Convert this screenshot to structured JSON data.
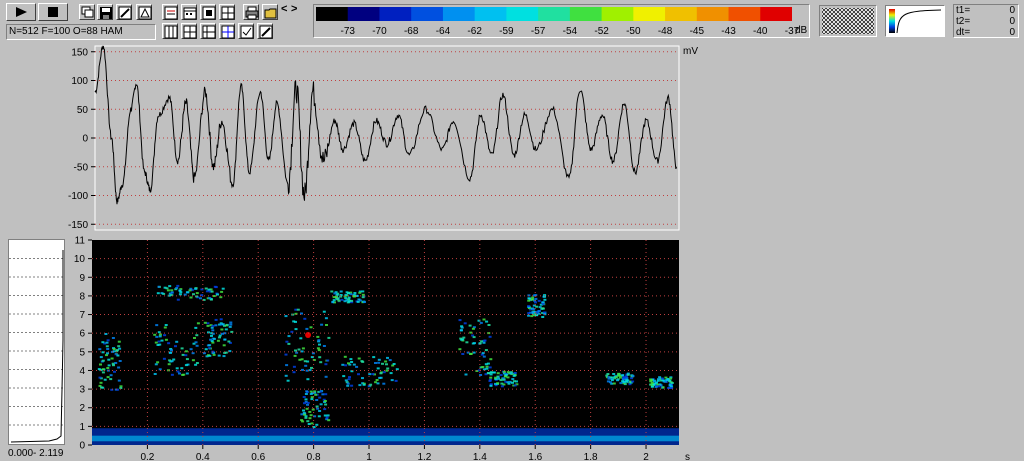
{
  "status": {
    "params": "N=512 F=100 O=88 HAM",
    "range": "0.000- 2.119"
  },
  "toolbar": {
    "play_icon": "play-icon",
    "stop_icon": "stop-icon",
    "nav_left": "<",
    "nav_right": ">"
  },
  "colorbar": {
    "ticks": [
      "-73",
      "-70",
      "-68",
      "-64",
      "-62",
      "-59",
      "-57",
      "-54",
      "-52",
      "-50",
      "-48",
      "-45",
      "-43",
      "-40",
      "-37"
    ],
    "unit": "dB",
    "colors": [
      "#000000",
      "#000080",
      "#0020c0",
      "#0050e0",
      "#0090f0",
      "#00c0f0",
      "#00e0e0",
      "#20e0a0",
      "#40e040",
      "#a0f000",
      "#f0f000",
      "#f0c000",
      "#f09000",
      "#f05000",
      "#e00000"
    ]
  },
  "cursor_info": {
    "t1_label": "t1=",
    "t1_value": "0",
    "t2_label": "t2=",
    "t2_value": "0",
    "dt_label": "dt=",
    "dt_value": "0"
  },
  "chart_data": [
    {
      "type": "line",
      "ylabel": "mV",
      "ylim": [
        -160,
        160
      ],
      "yticks": [
        "150",
        "100",
        "50",
        "0",
        "-50",
        "-100",
        "-150"
      ],
      "xlim": [
        0,
        2.119
      ],
      "grid": true,
      "series": [
        {
          "values_description_points": [
            [
              0.0,
              80
            ],
            [
              0.03,
              160
            ],
            [
              0.06,
              0
            ],
            [
              0.08,
              -110
            ],
            [
              0.1,
              -80
            ],
            [
              0.13,
              50
            ],
            [
              0.15,
              95
            ],
            [
              0.18,
              -60
            ],
            [
              0.2,
              -90
            ],
            [
              0.23,
              40
            ],
            [
              0.27,
              70
            ],
            [
              0.3,
              -40
            ],
            [
              0.33,
              60
            ],
            [
              0.36,
              -70
            ],
            [
              0.4,
              80
            ],
            [
              0.43,
              -50
            ],
            [
              0.46,
              30
            ],
            [
              0.5,
              -80
            ],
            [
              0.53,
              90
            ],
            [
              0.56,
              -60
            ],
            [
              0.6,
              80
            ],
            [
              0.63,
              -40
            ],
            [
              0.66,
              60
            ],
            [
              0.7,
              -80
            ],
            [
              0.73,
              85
            ],
            [
              0.76,
              -100
            ],
            [
              0.79,
              80
            ],
            [
              0.83,
              -40
            ],
            [
              0.87,
              30
            ],
            [
              0.9,
              -20
            ],
            [
              0.94,
              25
            ],
            [
              0.98,
              -40
            ],
            [
              1.02,
              30
            ],
            [
              1.06,
              -10
            ],
            [
              1.1,
              40
            ],
            [
              1.14,
              -30
            ],
            [
              1.2,
              50
            ],
            [
              1.26,
              -20
            ],
            [
              1.3,
              30
            ],
            [
              1.36,
              -70
            ],
            [
              1.4,
              40
            ],
            [
              1.44,
              -30
            ],
            [
              1.48,
              75
            ],
            [
              1.52,
              -30
            ],
            [
              1.56,
              40
            ],
            [
              1.6,
              -20
            ],
            [
              1.66,
              50
            ],
            [
              1.72,
              -70
            ],
            [
              1.76,
              85
            ],
            [
              1.8,
              -20
            ],
            [
              1.84,
              40
            ],
            [
              1.88,
              -40
            ],
            [
              1.92,
              60
            ],
            [
              1.96,
              -60
            ],
            [
              2.0,
              30
            ],
            [
              2.04,
              -40
            ],
            [
              2.08,
              70
            ],
            [
              2.11,
              -50
            ]
          ]
        }
      ]
    },
    {
      "type": "heatmap",
      "xlabel": "s",
      "xlim": [
        0,
        2.119
      ],
      "xticks": [
        "0.2",
        "0.4",
        "0.6",
        "0.8",
        "1",
        "1.2",
        "1.4",
        "1.6",
        "1.8",
        "2"
      ],
      "ylim": [
        0,
        11
      ],
      "yticks": [
        "11",
        "10",
        "9",
        "8",
        "7",
        "6",
        "5",
        "4",
        "3",
        "2",
        "1",
        "0"
      ],
      "grid": true
    }
  ]
}
